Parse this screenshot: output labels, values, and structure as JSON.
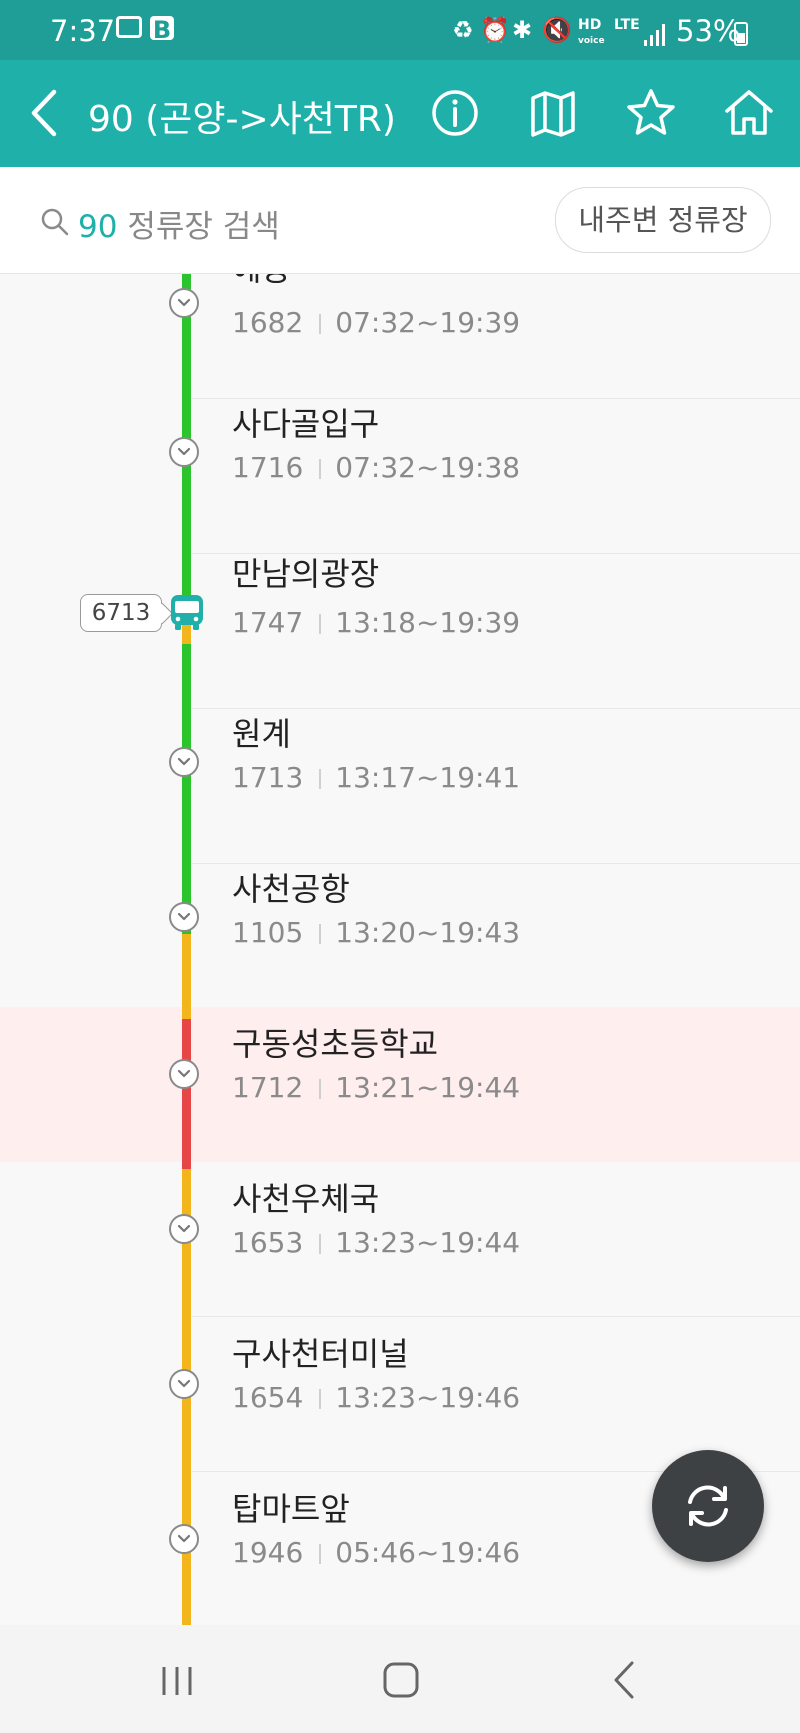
{
  "status_bar": {
    "time": "7:37",
    "network": "LTE",
    "battery": "53%"
  },
  "app_bar": {
    "title": "90 (곤양->사천TR)",
    "actions": [
      "info-icon",
      "map-icon",
      "star-icon",
      "home-icon"
    ]
  },
  "search": {
    "route_number": "90",
    "label": "정류장 검색",
    "nearby_button": "내주변 정류장"
  },
  "colors": {
    "brand": "#1fb0aa",
    "status_bar": "#1f9e98",
    "line_green": "#2cc42c",
    "line_yellow": "#f2b51c",
    "line_red": "#e64646",
    "selected_row": "#ffeeee"
  },
  "bus": {
    "plate": "6713"
  },
  "stops": [
    {
      "name": "예동",
      "id": "1682",
      "hours": "07:32~19:39"
    },
    {
      "name": "사다골입구",
      "id": "1716",
      "hours": "07:32~19:38"
    },
    {
      "name": "만남의광장",
      "id": "1747",
      "hours": "13:18~19:39"
    },
    {
      "name": "원계",
      "id": "1713",
      "hours": "13:17~19:41"
    },
    {
      "name": "사천공항",
      "id": "1105",
      "hours": "13:20~19:43"
    },
    {
      "name": "구동성초등학교",
      "id": "1712",
      "hours": "13:21~19:44"
    },
    {
      "name": "사천우체국",
      "id": "1653",
      "hours": "13:23~19:44"
    },
    {
      "name": "구사천터미널",
      "id": "1654",
      "hours": "13:23~19:46"
    },
    {
      "name": "탑마트앞",
      "id": "1946",
      "hours": "05:46~19:46"
    }
  ]
}
